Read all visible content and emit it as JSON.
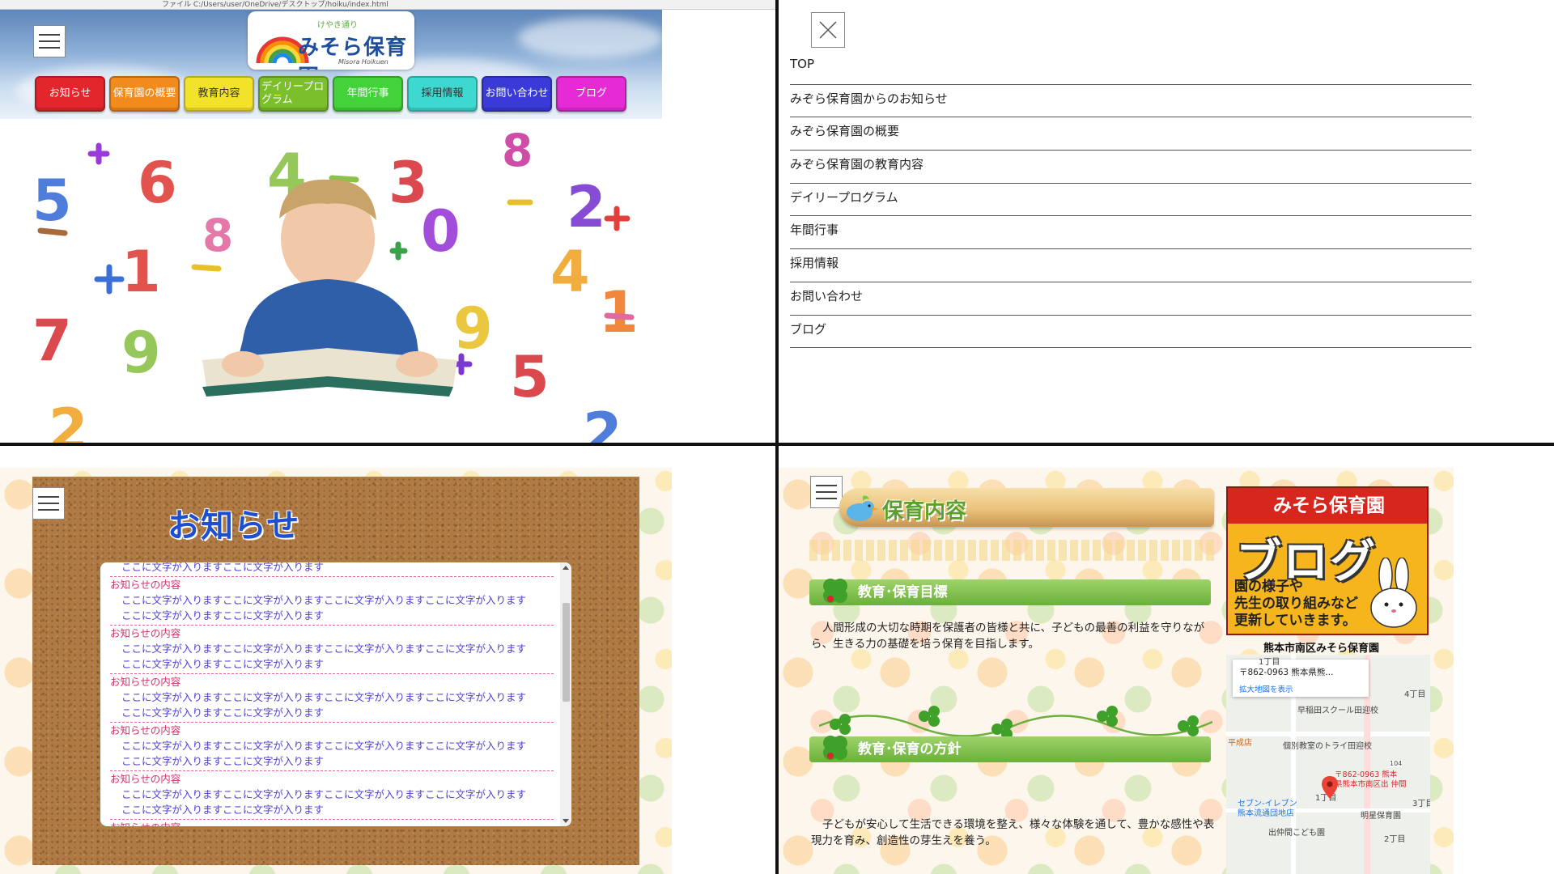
{
  "browser": {
    "address": "ファイル C:/Users/user/OneDrive/デスクトップ/hoiku/index.html"
  },
  "site": {
    "logo_sub": "けやき通り",
    "logo_title": "みそら保育園",
    "logo_roman": "Misora Hoikuen"
  },
  "nav": [
    {
      "label": "お知らせ",
      "color": "#e2262c"
    },
    {
      "label": "保育園の概要",
      "color": "#f28a1c"
    },
    {
      "label": "教育内容",
      "color": "#f3e22a"
    },
    {
      "label": "デイリープログラム",
      "color": "#7bbf2a"
    },
    {
      "label": "年間行事",
      "color": "#43d23a"
    },
    {
      "label": "採用情報",
      "color": "#3dd8cf"
    },
    {
      "label": "お問い合わせ",
      "color": "#3a3ad8"
    },
    {
      "label": "ブログ",
      "color": "#e52ad6"
    }
  ],
  "menu": {
    "items": [
      "TOP",
      "みぞら保育園からのお知らせ",
      "みぞら保育園の概要",
      "みぞら保育園の教育内容",
      "デイリープログラム",
      "年間行事",
      "採用情報",
      "お問い合わせ",
      "ブログ"
    ]
  },
  "notices": {
    "title": "お知らせ",
    "first_line": "ここに文字が入りますここに文字が入ります",
    "items": [
      {
        "head": "お知らせの内容",
        "line1": "ここに文字が入りますここに文字が入りますここに文字が入りますここに文字が入ります",
        "line2": "ここに文字が入りますここに文字が入ります"
      },
      {
        "head": "お知らせの内容",
        "line1": "ここに文字が入りますここに文字が入りますここに文字が入りますここに文字が入ります",
        "line2": "ここに文字が入りますここに文字が入ります"
      },
      {
        "head": "お知らせの内容",
        "line1": "ここに文字が入りますここに文字が入りますここに文字が入りますここに文字が入ります",
        "line2": "ここに文字が入りますここに文字が入ります"
      },
      {
        "head": "お知らせの内容",
        "line1": "ここに文字が入りますここに文字が入りますここに文字が入りますここに文字が入ります",
        "line2": "ここに文字が入りますここに文字が入ります"
      },
      {
        "head": "お知らせの内容",
        "line1": "ここに文字が入りますここに文字が入りますここに文字が入りますここに文字が入ります",
        "line2": "ここに文字が入りますここに文字が入ります"
      }
    ],
    "last_partial": "お知らせの内容"
  },
  "education": {
    "page_title": "保育内容",
    "goal_heading": "教育･保育目標",
    "goal_text": "人間形成の大切な時期を保護者の皆様と共に、子どもの最善の利益を守りながら、生きる力の基礎を培う保育を目指します。",
    "policy_heading": "教育･保育の方針",
    "policy_text": "子どもが安心して生活できる環境を整え、様々な体験を通して、豊かな感性や表現力を育み、創造性の芽生えを養う。"
  },
  "blog_banner": {
    "top": "みそら保育園",
    "big": "ブログ",
    "line1": "園の様子や",
    "line2": "先生の取り組みなど",
    "line3": "更新していきます。"
  },
  "map": {
    "title": "熊本市南区みそら保育園",
    "card_addr": "〒862-0963 熊本県熊...",
    "card_link": "拡大地図を表示",
    "labels": [
      "1丁目",
      "4丁目",
      "早稲田スクール田迎校",
      "平成店",
      "個別教室のトライ田迎校",
      "104",
      "〒862-0963 熊本",
      "県熊本市南区出 仲間",
      "1丁目",
      "セブン-イレブン",
      "熊本流通団地店",
      "明星保育園",
      "出仲間こども園",
      "2丁目",
      "3丁目"
    ]
  },
  "colors": {
    "notice_head": "#d0336c",
    "notice_body": "#4b3fd1",
    "notice_title": "#1f4fd1",
    "section_green": "#6ab03a"
  }
}
